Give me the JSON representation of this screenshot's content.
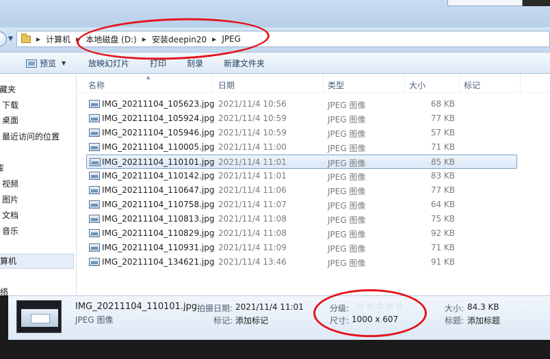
{
  "address": {
    "crumbs": [
      "计算机",
      "本地磁盘 (D:)",
      "安装deepin20",
      "JPEG"
    ]
  },
  "toolbar": {
    "preview_label": "预览",
    "slideshow_label": "放映幻灯片",
    "print_label": "打印",
    "burn_label": "刻录",
    "new_folder_label": "新建文件夹"
  },
  "sidebar": {
    "items": [
      {
        "label": "收藏夹"
      },
      {
        "label": "下载"
      },
      {
        "label": "桌面"
      },
      {
        "label": "最近访问的位置"
      },
      {
        "label": "库"
      },
      {
        "label": "视频"
      },
      {
        "label": "图片"
      },
      {
        "label": "文档"
      },
      {
        "label": "音乐"
      },
      {
        "label": "计算机"
      },
      {
        "label": "网络"
      }
    ]
  },
  "columns": {
    "name": "名称",
    "date": "日期",
    "type": "类型",
    "size": "大小",
    "tags": "标记"
  },
  "files": [
    {
      "name": "IMG_20211104_105623.jpg",
      "date": "2021/11/4 10:56",
      "type": "JPEG 图像",
      "size": "68 KB"
    },
    {
      "name": "IMG_20211104_105924.jpg",
      "date": "2021/11/4 10:59",
      "type": "JPEG 图像",
      "size": "77 KB"
    },
    {
      "name": "IMG_20211104_105946.jpg",
      "date": "2021/11/4 10:59",
      "type": "JPEG 图像",
      "size": "57 KB"
    },
    {
      "name": "IMG_20211104_110005.jpg",
      "date": "2021/11/4 11:00",
      "type": "JPEG 图像",
      "size": "71 KB"
    },
    {
      "name": "IMG_20211104_110101.jpg",
      "date": "2021/11/4 11:01",
      "type": "JPEG 图像",
      "size": "85 KB"
    },
    {
      "name": "IMG_20211104_110142.jpg",
      "date": "2021/11/4 11:01",
      "type": "JPEG 图像",
      "size": "83 KB"
    },
    {
      "name": "IMG_20211104_110647.jpg",
      "date": "2021/11/4 11:06",
      "type": "JPEG 图像",
      "size": "77 KB"
    },
    {
      "name": "IMG_20211104_110758.jpg",
      "date": "2021/11/4 11:07",
      "type": "JPEG 图像",
      "size": "64 KB"
    },
    {
      "name": "IMG_20211104_110813.jpg",
      "date": "2021/11/4 11:08",
      "type": "JPEG 图像",
      "size": "75 KB"
    },
    {
      "name": "IMG_20211104_110829.jpg",
      "date": "2021/11/4 11:08",
      "type": "JPEG 图像",
      "size": "92 KB"
    },
    {
      "name": "IMG_20211104_110931.jpg",
      "date": "2021/11/4 11:09",
      "type": "JPEG 图像",
      "size": "71 KB"
    },
    {
      "name": "IMG_20211104_134621.jpg",
      "date": "2021/11/4 13:46",
      "type": "JPEG 图像",
      "size": "91 KB"
    }
  ],
  "details": {
    "filename": "IMG_20211104_110101.jpg",
    "filetype": "JPEG 图像",
    "date_taken_label": "拍摄日期:",
    "date_taken_value": "2021/11/4 11:01",
    "tags_label": "标记:",
    "tags_value": "添加标记",
    "rating_label": "分级:",
    "rating_stars": 0,
    "dimensions_label": "尺寸:",
    "dimensions_value": "1000 x 607",
    "size_label": "大小:",
    "size_value": "84.3 KB",
    "title_label": "标题:",
    "title_value": "添加标题"
  },
  "colors": {
    "annotation": "#e4141b",
    "selection_border": "#7da2ce"
  }
}
